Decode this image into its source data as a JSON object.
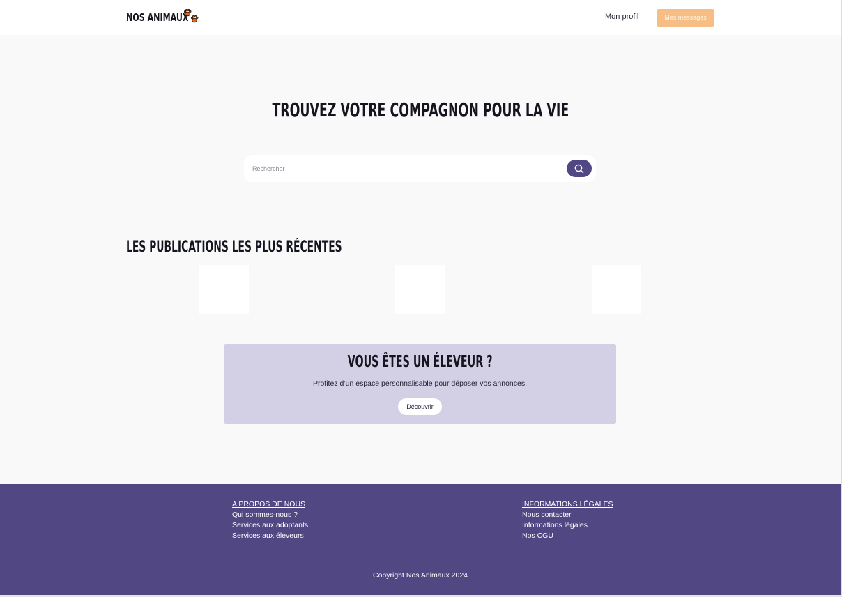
{
  "header": {
    "brand": "NOS ANIMAUX",
    "brand_icon": "paw-prints-icon",
    "nav_profile": "Mon profil",
    "nav_messages": "Mes messages"
  },
  "hero": {
    "title": "TROUVEZ VOTRE COMPAGNON POUR LA VIE",
    "search_placeholder": "Rechercher",
    "search_icon": "search-icon"
  },
  "recent": {
    "title": "LES PUBLICATIONS LES PLUS RÉCENTES",
    "cards": [
      {},
      {},
      {}
    ]
  },
  "promo": {
    "title": "VOUS ÊTES UN ÉLEVEUR ?",
    "text": "Profitez d’un espace personnalisable pour déposer vos annonces.",
    "button": "Découvrir"
  },
  "footer": {
    "about": {
      "heading": "A PROPOS DE NOUS",
      "links": [
        "Qui sommes-nous ?",
        "Services aux adoptants",
        "Services aux éleveurs"
      ]
    },
    "legal": {
      "heading": "INFORMATIONS LÉGALES",
      "links": [
        "Nous contacter",
        "Informations légales",
        "Nos CGU"
      ]
    },
    "copyright": "Copyright Nos Animaux 2024"
  },
  "colors": {
    "primary": "#514883",
    "accent": "#f6be84",
    "promo_bg": "#d3cfe4",
    "page_bg": "#f9f9f9"
  }
}
